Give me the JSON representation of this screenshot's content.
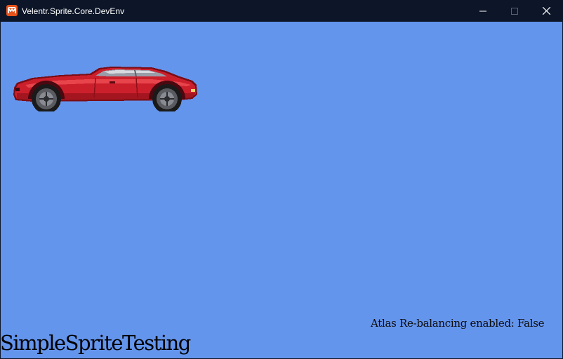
{
  "window": {
    "title": "Velentr.Sprite.Core.DevEnv",
    "controls": {
      "minimize_icon": "minimize-icon",
      "maximize_icon": "maximize-icon",
      "close_icon": "close-icon"
    }
  },
  "scene": {
    "background_color": "#6495ED",
    "sprite": "red-sports-car",
    "status_text": "Atlas Re-balancing enabled: False",
    "app_label": "SimpleSpriteTesting"
  }
}
